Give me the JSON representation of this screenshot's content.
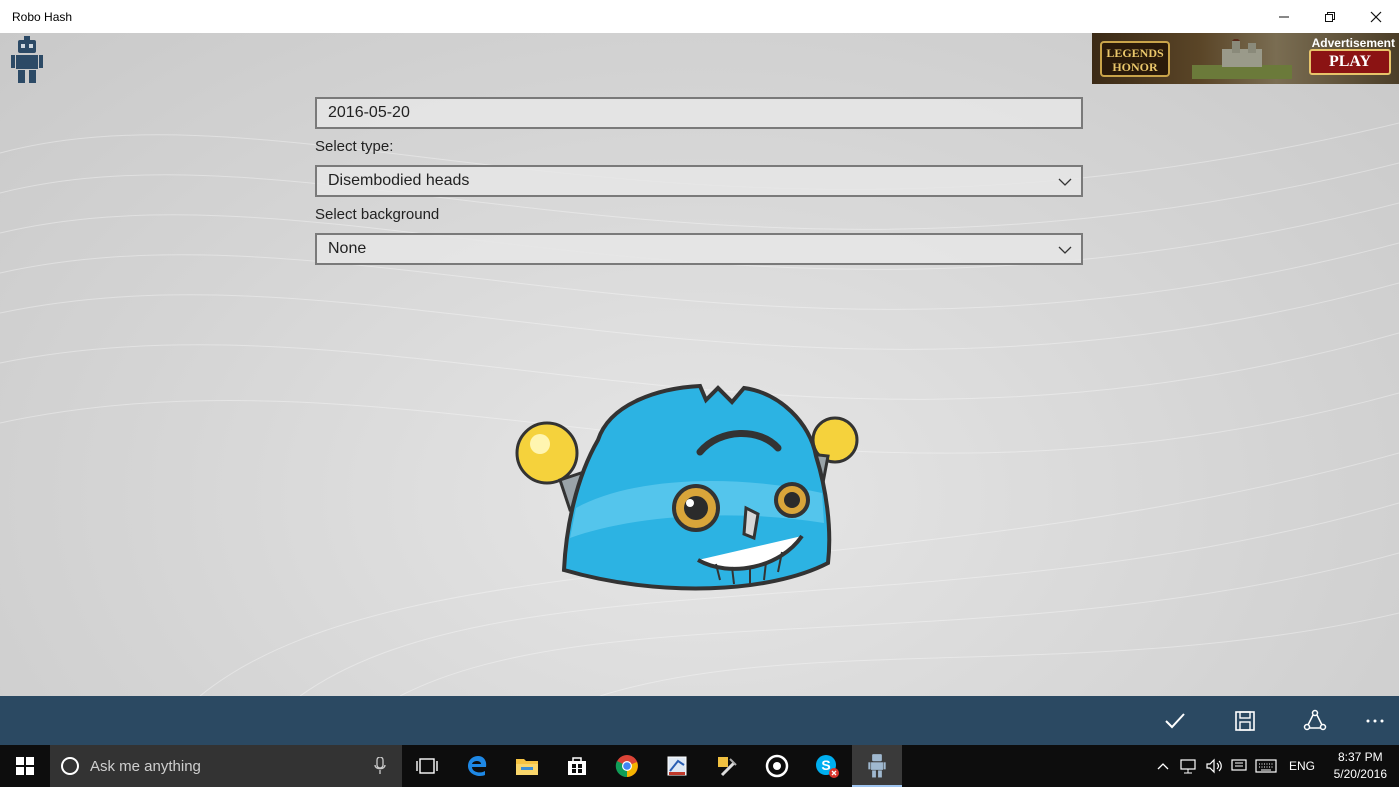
{
  "window": {
    "title": "Robo Hash",
    "minimize_icon": "minimize-icon",
    "restore_icon": "restore-icon",
    "close_icon": "close-icon"
  },
  "ad": {
    "label": "Advertisement",
    "game_name_line1": "LEGENDS",
    "game_name_line2": "HONOR",
    "cta": "PLAY"
  },
  "form": {
    "text_value": "2016-05-20",
    "type_label": "Select type:",
    "type_value": "Disembodied heads",
    "background_label": "Select background",
    "background_value": "None"
  },
  "robot": {
    "description_icon": "robot-head-image",
    "body_color": "#2cb3e3",
    "bulb_color": "#f5d23c"
  },
  "appbar": {
    "buttons": [
      "check-icon",
      "save-icon",
      "share-icon",
      "more-icon"
    ],
    "background": "#2b4962"
  },
  "taskbar": {
    "search_placeholder": "Ask me anything",
    "pinned": [
      "task-view-icon",
      "edge-icon",
      "file-explorer-icon",
      "store-icon",
      "chrome-icon",
      "paint-icon",
      "tools-icon",
      "media-icon",
      "skype-icon",
      "robohash-icon"
    ],
    "language": "ENG",
    "time": "8:37 PM",
    "date": "5/20/2016"
  }
}
